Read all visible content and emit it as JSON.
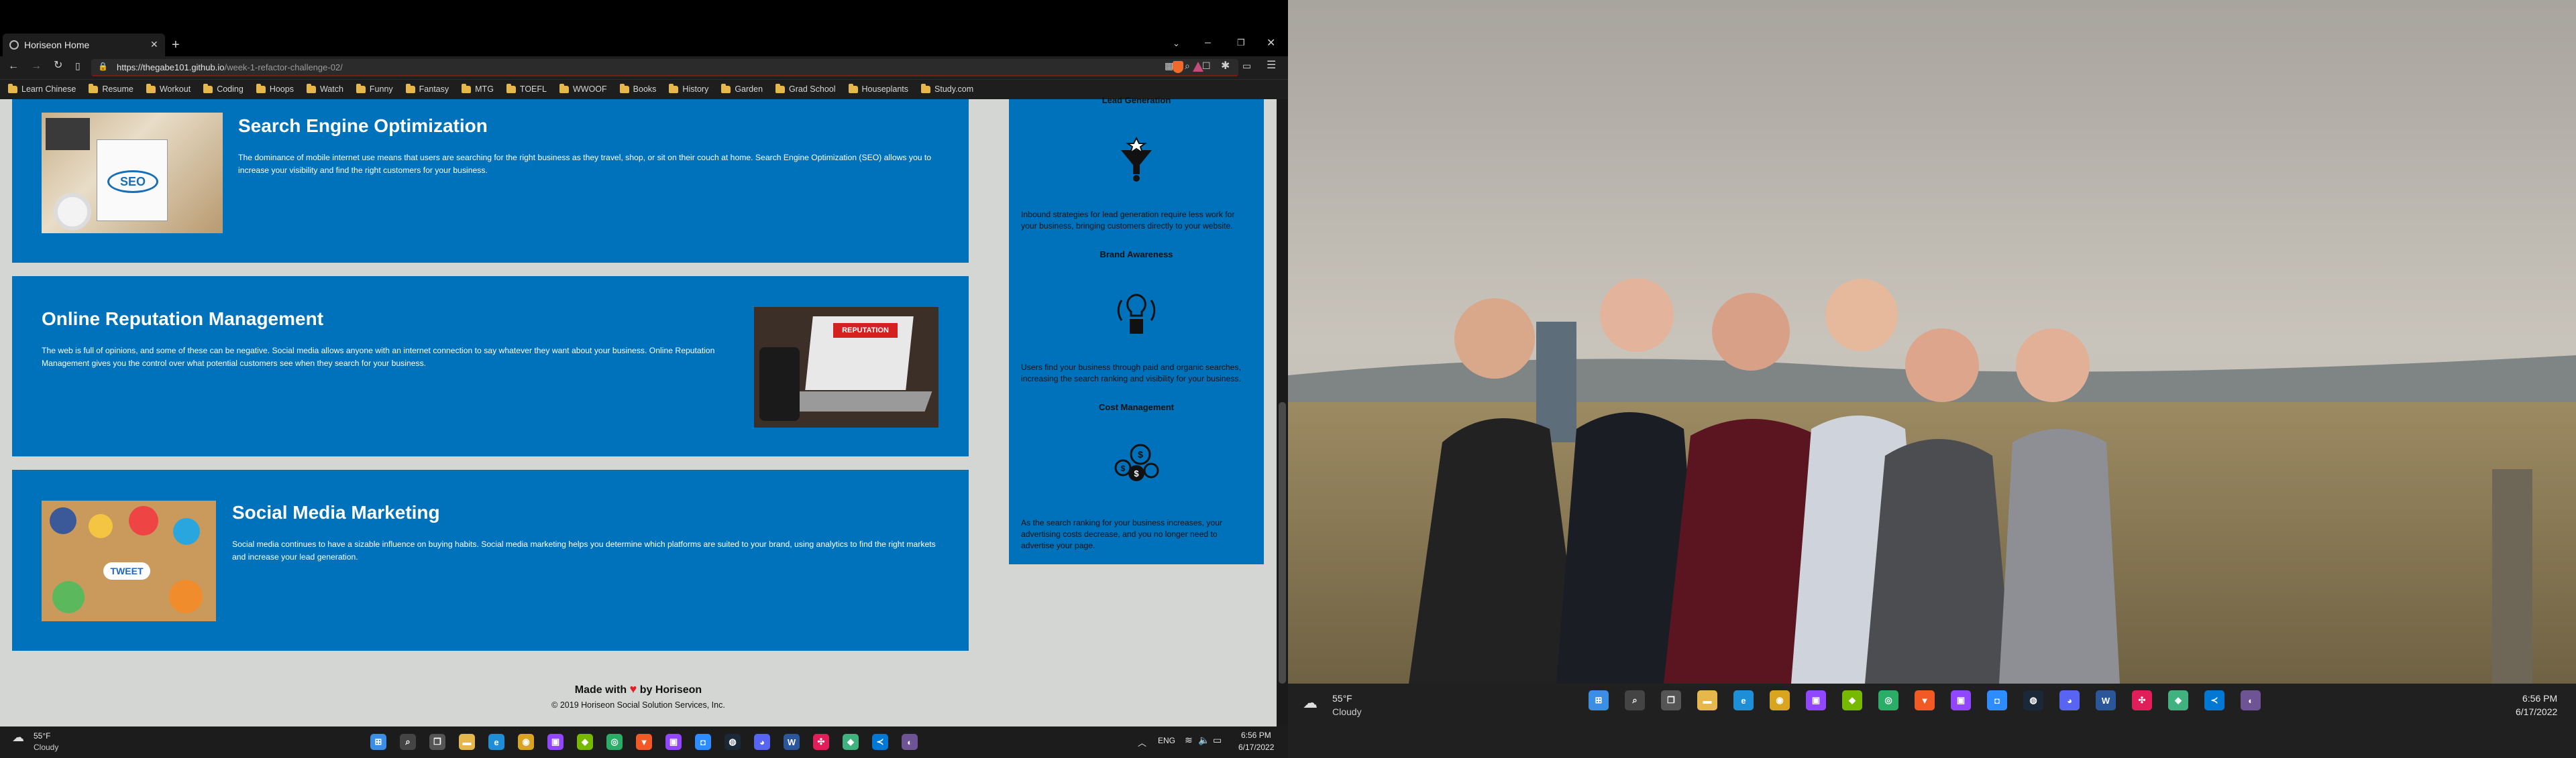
{
  "browser": {
    "tab_title": "Horiseon Home",
    "url_host": "https://thegabe101.github.io",
    "url_path": "/week-1-refactor-challenge-02/",
    "bookmarks": [
      "Learn Chinese",
      "Resume",
      "Workout",
      "Coding",
      "Hoops",
      "Watch",
      "Funny",
      "Fantasy",
      "MTG",
      "TOEFL",
      "WWOOF",
      "Books",
      "History",
      "Garden",
      "Grad School",
      "Houseplants",
      "Study.com"
    ]
  },
  "page": {
    "sections": [
      {
        "title": "Search Engine Optimization",
        "text": "The dominance of mobile internet use means that users are searching for the right business as they travel, shop, or sit on their couch at home. Search Engine Optimization (SEO) allows you to increase your visibility and find the right customers for your business.",
        "image_label": "SEO"
      },
      {
        "title": "Online Reputation Management",
        "text": "The web is full of opinions, and some of these can be negative. Social media allows anyone with an internet connection to say whatever they want about your business. Online Reputation Management gives you the control over what potential customers see when they search for your business.",
        "image_label": "REPUTATION"
      },
      {
        "title": "Social Media Marketing",
        "text": "Social media continues to have a sizable influence on buying habits. Social media marketing helps you determine which platforms are suited to your brand, using analytics to find the right markets and increase your lead generation.",
        "image_label": "TWEET"
      }
    ],
    "benefits": [
      {
        "title": "Lead Generation",
        "text": "Inbound strategies for lead generation require less work for your business, bringing customers directly to your website."
      },
      {
        "title": "Brand Awareness",
        "text": "Users find your business through paid and organic searches, increasing the search ranking and visibility for your business."
      },
      {
        "title": "Cost Management",
        "text": "As the search ranking for your business increases, your advertising costs decrease, and you no longer need to advertise your page."
      }
    ],
    "footer": {
      "made_prefix": "Made with",
      "made_suffix": "by Horiseon",
      "copyright": "© 2019 Horiseon Social Solution Services, Inc."
    }
  },
  "taskbar_left": {
    "weather_temp": "55°F",
    "weather_desc": "Cloudy",
    "lang": "ENG",
    "time": "6:56 PM",
    "date": "6/17/2022"
  },
  "taskbar_right": {
    "weather_temp": "55°F",
    "weather_desc": "Cloudy",
    "time": "6:56 PM",
    "date": "6/17/2022"
  },
  "colors": {
    "accent": "#0072bb",
    "page_bg": "#d4d6d4",
    "heart": "#e02020"
  }
}
